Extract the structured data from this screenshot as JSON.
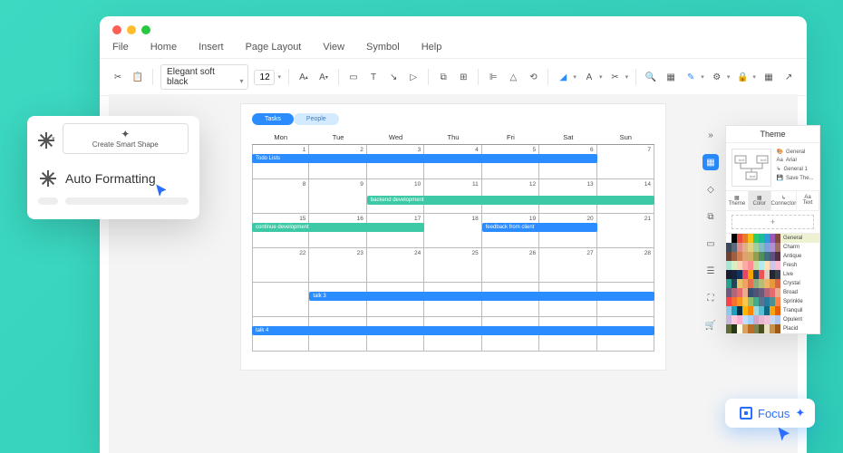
{
  "menu": {
    "file": "File",
    "home": "Home",
    "insert": "Insert",
    "page_layout": "Page Layout",
    "view": "View",
    "symbol": "Symbol",
    "help": "Help"
  },
  "toolbar": {
    "font": "Elegant soft black",
    "size": "12"
  },
  "calendar": {
    "tabs": [
      "Tasks",
      "People"
    ],
    "days": [
      "Mon",
      "Tue",
      "Wed",
      "Thu",
      "Fri",
      "Sat",
      "Sun"
    ],
    "rows": [
      [
        1,
        2,
        3,
        4,
        5,
        6,
        7
      ],
      [
        8,
        9,
        10,
        11,
        12,
        13,
        14
      ],
      [
        15,
        16,
        17,
        18,
        19,
        20,
        21
      ],
      [
        22,
        23,
        24,
        25,
        26,
        27,
        28
      ],
      [
        "",
        "",
        "",
        "",
        "",
        "",
        ""
      ],
      [
        "",
        "",
        "",
        "",
        "",
        "",
        ""
      ]
    ],
    "events": {
      "todo": "Todo Lists",
      "backend": "backend development",
      "continue": "continue development",
      "feedback": "feedback from client",
      "talk3": "talk 3",
      "talk4": "talk 4"
    }
  },
  "popover": {
    "smart_shape": "Create Smart Shape",
    "auto_formatting": "Auto Formatting"
  },
  "theme": {
    "title": "Theme",
    "preview": {
      "general": "General",
      "arial": "Arial",
      "general1": "General 1",
      "save": "Save The..."
    },
    "tabs": {
      "theme": "Theme",
      "color": "Color",
      "connector": "Connector",
      "text": "Text"
    },
    "schemes": [
      "General",
      "Charm",
      "Antique",
      "Fresh",
      "Live",
      "Crystal",
      "Broad",
      "Sprinkle",
      "Tranquil",
      "Opulent",
      "Placid"
    ]
  },
  "focus": {
    "label": "Focus"
  },
  "swatch_colors": [
    [
      "#fff",
      "#000",
      "#e74c3c",
      "#e67e22",
      "#f1c40f",
      "#2ecc71",
      "#1abc9c",
      "#3498db",
      "#9b59b6",
      "#7e4b3a"
    ],
    [
      "#3a4a5a",
      "#5a6a7a",
      "#e08a8a",
      "#e0b080",
      "#e0d080",
      "#a0d0a0",
      "#80c0c0",
      "#80a0e0",
      "#b090d0",
      "#a07060"
    ],
    [
      "#704030",
      "#a06040",
      "#d08050",
      "#e0a070",
      "#d0b060",
      "#90a050",
      "#509060",
      "#407080",
      "#605080",
      "#503040"
    ],
    [
      "#a8e6cf",
      "#dcedc1",
      "#ffd3b6",
      "#ffaaa5",
      "#ff8b94",
      "#c5e1a5",
      "#b2ebf2",
      "#ffe0b2",
      "#d1c4e9",
      "#f8bbd0"
    ],
    [
      "#1a1a2e",
      "#16213e",
      "#0f3460",
      "#e94560",
      "#f0a500",
      "#2d4059",
      "#ea5455",
      "#decdc3",
      "#222831",
      "#393e46"
    ],
    [
      "#2a9d8f",
      "#264653",
      "#e9c46a",
      "#f4a261",
      "#e76f51",
      "#8ab17d",
      "#babb74",
      "#efb366",
      "#e9983d",
      "#d66745"
    ],
    [
      "#6d597a",
      "#b56576",
      "#e56b6f",
      "#eaac8b",
      "#355070",
      "#515575",
      "#6d597a",
      "#b56576",
      "#e56b6f",
      "#eaac8b"
    ],
    [
      "#f94144",
      "#f3722c",
      "#f8961e",
      "#f9c74f",
      "#90be6d",
      "#43aa8b",
      "#577590",
      "#277da1",
      "#4d908e",
      "#f9844a"
    ],
    [
      "#8ecae6",
      "#219ebc",
      "#023047",
      "#ffb703",
      "#fb8500",
      "#9fd8df",
      "#56c1d6",
      "#126782",
      "#fca311",
      "#e85d04"
    ],
    [
      "#cdb4db",
      "#ffc8dd",
      "#ffafcc",
      "#bde0fe",
      "#a2d2ff",
      "#d4a5c9",
      "#e6b8d0",
      "#f0c0d8",
      "#c8d8f0",
      "#b0c8f0"
    ],
    [
      "#606c38",
      "#283618",
      "#fefae0",
      "#dda15e",
      "#bc6c25",
      "#7a8450",
      "#4a5020",
      "#e8e0c0",
      "#c89048",
      "#a05818"
    ]
  ]
}
